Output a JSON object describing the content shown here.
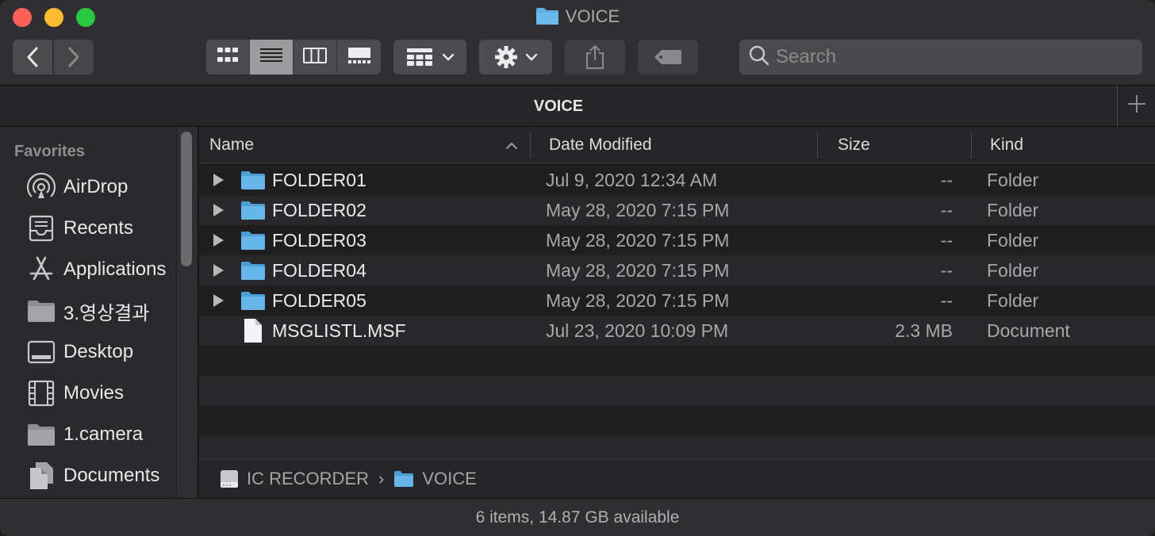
{
  "window": {
    "title": "VOICE"
  },
  "toolbar": {
    "back_icon": "chevron-left-icon",
    "forward_icon": "chevron-right-icon",
    "view_modes": [
      "icon-view",
      "list-view",
      "column-view",
      "gallery-view"
    ],
    "active_view": "list-view",
    "search_placeholder": "Search"
  },
  "tab": {
    "title": "VOICE",
    "add_label": "+"
  },
  "sidebar": {
    "section_title": "Favorites",
    "items": [
      {
        "label": "AirDrop",
        "icon": "airdrop-icon"
      },
      {
        "label": "Recents",
        "icon": "recents-icon"
      },
      {
        "label": "Applications",
        "icon": "applications-icon"
      },
      {
        "label": "3.영상결과",
        "icon": "folder-icon"
      },
      {
        "label": "Desktop",
        "icon": "desktop-icon"
      },
      {
        "label": "Movies",
        "icon": "movies-icon"
      },
      {
        "label": "1.camera",
        "icon": "folder-icon"
      },
      {
        "label": "Documents",
        "icon": "documents-icon"
      }
    ]
  },
  "columns": {
    "name": "Name",
    "date": "Date Modified",
    "size": "Size",
    "kind": "Kind"
  },
  "files": [
    {
      "name": "FOLDER01",
      "date": "Jul 9, 2020 12:34 AM",
      "size": "--",
      "kind": "Folder",
      "type": "folder"
    },
    {
      "name": "FOLDER02",
      "date": "May 28, 2020 7:15 PM",
      "size": "--",
      "kind": "Folder",
      "type": "folder"
    },
    {
      "name": "FOLDER03",
      "date": "May 28, 2020 7:15 PM",
      "size": "--",
      "kind": "Folder",
      "type": "folder"
    },
    {
      "name": "FOLDER04",
      "date": "May 28, 2020 7:15 PM",
      "size": "--",
      "kind": "Folder",
      "type": "folder"
    },
    {
      "name": "FOLDER05",
      "date": "May 28, 2020 7:15 PM",
      "size": "--",
      "kind": "Folder",
      "type": "folder"
    },
    {
      "name": "MSGLISTL.MSF",
      "date": "Jul 23, 2020 10:09 PM",
      "size": "2.3 MB",
      "kind": "Document",
      "type": "document"
    }
  ],
  "pathbar": {
    "items": [
      {
        "label": "IC RECORDER",
        "icon": "drive-icon"
      },
      {
        "label": "VOICE",
        "icon": "folder-icon"
      }
    ]
  },
  "status": {
    "text": "6 items, 14.87 GB available"
  },
  "colors": {
    "folder_blue": "#5aaee0",
    "background": "#1e1e1e",
    "sidebar": "#2a2a2c"
  }
}
